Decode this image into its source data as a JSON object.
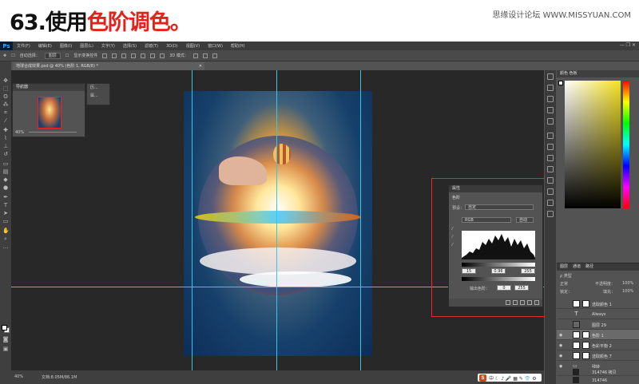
{
  "banner": {
    "title_prefix": "63.使用",
    "title_highlight": "色阶调色。",
    "site": "思缘设计论坛  WWW.MISSYUAN.COM"
  },
  "app": {
    "logo": "Ps",
    "menu": [
      "文件(F)",
      "编辑(E)",
      "图像(I)",
      "图层(L)",
      "文字(Y)",
      "选择(S)",
      "滤镜(T)",
      "3D(D)",
      "视图(V)",
      "窗口(W)",
      "帮助(H)"
    ],
    "window_controls": "—  ❐  ✕"
  },
  "options_bar": {
    "auto_select": "自动选择：",
    "auto_select_value": "图层",
    "show_transform": "显示变换控件",
    "mode_3d": "3D 模式："
  },
  "document": {
    "tab_title": "地球合成效果.psd @ 40% (色阶 1, RGB/8) *",
    "close": "✕"
  },
  "navigator": {
    "title": "导航器",
    "zoom": "40%",
    "mini_items": [
      "历...",
      "属..."
    ]
  },
  "properties": {
    "title": "属性",
    "subtitle": "色阶",
    "preset_label": "预设：",
    "preset_value": "自定",
    "channel": "RGB",
    "auto_label": "自动",
    "input_black": "15",
    "input_gamma": "0.96",
    "input_white": "255",
    "output_label": "输出色阶：",
    "output_black": "0",
    "output_white": "255"
  },
  "color_panel": {
    "tabs": [
      "颜色",
      "色板"
    ]
  },
  "layers_panel": {
    "tabs": [
      "图层",
      "通道",
      "路径"
    ],
    "kind_filter": "ρ 类型",
    "blend_mode": "正常",
    "opacity_label": "不透明度：",
    "opacity": "100%",
    "lock_label": "锁定：",
    "fill_label": "填充：",
    "fill": "100%",
    "layers": [
      {
        "name": "选取颜色 1",
        "selected": false
      },
      {
        "name": "Always",
        "selected": false
      },
      {
        "name": "图层 29",
        "selected": false
      },
      {
        "name": "色阶 1",
        "selected": true
      },
      {
        "name": "色彩平衡 2",
        "selected": false
      },
      {
        "name": "选取颜色 7",
        "selected": false
      },
      {
        "name": "残转",
        "selected": false
      },
      {
        "name": "314746 拷贝",
        "selected": false
      },
      {
        "name": "314746",
        "selected": false
      }
    ]
  },
  "status": {
    "zoom": "40%",
    "doc_size": "文档:8.05M/86.1M"
  },
  "ime": {
    "logo": "S",
    "glyphs": "中 ☾ ♪ 🎤 ▦ ✎ 👕 ⚙"
  },
  "colors": {
    "accent_red": "#e1231e",
    "guide": "#36c8e0",
    "highlight_box": "#e82a2a"
  }
}
